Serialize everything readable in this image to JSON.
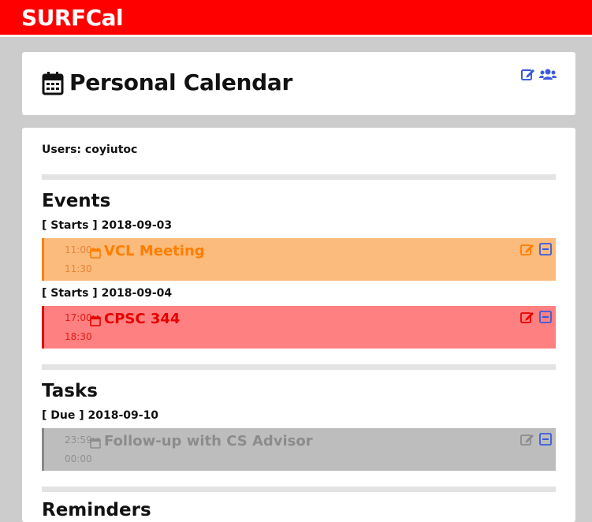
{
  "app": {
    "brand": "SURFCal"
  },
  "header": {
    "title": "Personal Calendar"
  },
  "users": {
    "label": "Users: coyiutoc"
  },
  "events": {
    "title": "Events",
    "groups": [
      {
        "head": "[ Starts ] 2018-09-03",
        "item": {
          "start": "11:00",
          "end": "11:30",
          "title": "VCL Meeting"
        }
      },
      {
        "head": "[ Starts ] 2018-09-04",
        "item": {
          "start": "17:00",
          "end": "18:30",
          "title": "CPSC 344"
        }
      }
    ]
  },
  "tasks": {
    "title": "Tasks",
    "groups": [
      {
        "head": "[ Due ] 2018-09-10",
        "item": {
          "start": "23:59",
          "end": "00:00",
          "title": "Follow-up with CS Advisor"
        }
      }
    ]
  },
  "next_section": {
    "title": "Reminders"
  },
  "colors": {
    "brand": "#ff0000",
    "event_orange": "#fabb7c",
    "event_red": "#ff8080",
    "task_grey": "#bdbdbd",
    "action_blue": "#3b5bdb"
  },
  "icons": [
    "calendar-icon",
    "edit-icon",
    "users-icon",
    "remove-icon"
  ]
}
